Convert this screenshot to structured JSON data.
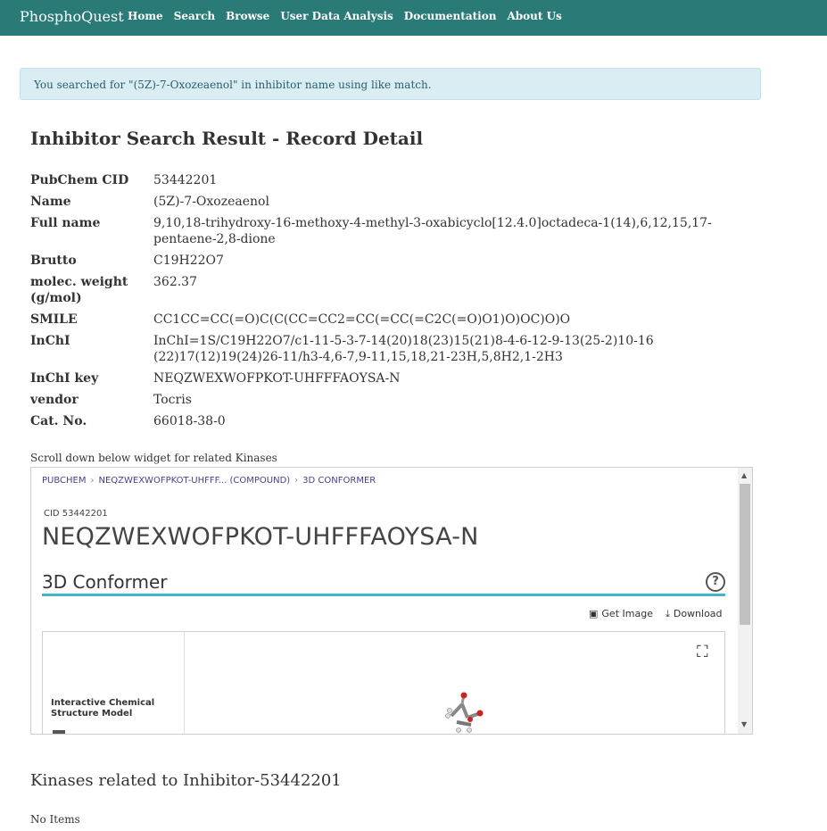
{
  "navbar": {
    "brand": "PhosphoQuest",
    "links": [
      "Home",
      "Search",
      "Browse",
      "User Data Analysis",
      "Documentation",
      "About Us"
    ]
  },
  "alert": "You searched for \"(5Z)-7-Oxozeaenol\" in inhibitor name using like match.",
  "page_title": "Inhibitor Search Result - Record Detail",
  "details": [
    {
      "key": "PubChem CID",
      "value": "53442201"
    },
    {
      "key": "Name",
      "value": "(5Z)-7-Oxozeaenol"
    },
    {
      "key": "Full name",
      "value": "9,10,18-trihydroxy-16-methoxy-4-methyl-3-oxabicyclo[12.4.0]octadeca-1(14),6,12,15,17-pentaene-2,8-dione"
    },
    {
      "key": "Brutto",
      "value": "C19H22O7"
    },
    {
      "key": "molec. weight (g/mol)",
      "value": "362.37"
    },
    {
      "key": "SMILE",
      "value": "CC1CC=CC(=O)C(C(CC=CC2=CC(=CC(=C2C(=O)O1)O)OC)O)O"
    },
    {
      "key": "InChI",
      "value": "InChI=1S/C19H22O7/c1-11-5-3-7-14(20)18(23)15(21)8-4-6-12-9-13(25-2)10-16 (22)17(12)19(24)26-11/h3-4,6-7,9-11,15,18,21-23H,5,8H2,1-2H3"
    },
    {
      "key": "InChI key",
      "value": "NEQZWEXWOFPKOT-UHFFFAOYSA-N"
    },
    {
      "key": "vendor",
      "value": "Tocris"
    },
    {
      "key": "Cat. No.",
      "value": "66018-38-0"
    }
  ],
  "scroll_note": "Scroll down below widget for related Kinases",
  "widget": {
    "breadcrumbs": [
      "PUBCHEM",
      "NEQZWEXWOFPKOT-UHFFF... (COMPOUND)",
      "3D CONFORMER"
    ],
    "cid_label": "CID 53442201",
    "title": "NEQZWEXWOFPKOT-UHFFFAOYSA-N",
    "section_title": "3D Conformer",
    "get_image": "Get Image",
    "download": "Download",
    "side_label": "Interactive Chemical Structure Model"
  },
  "kinases_title": "Kinases related to Inhibitor-53442201",
  "no_items": "No Items"
}
